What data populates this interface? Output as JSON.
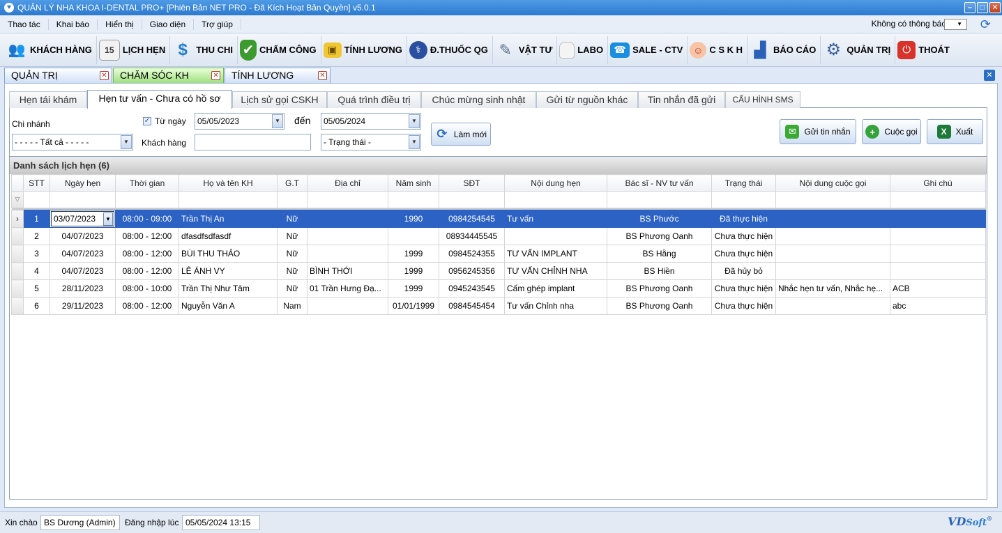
{
  "window": {
    "title": "QUẢN LÝ NHA KHOA I-DENTAL PRO+ [Phiên Bản NET PRO - Đã Kích Hoạt Bản Quyền] v5.0.1"
  },
  "menu": {
    "items": [
      "Thao tác",
      "Khai báo",
      "Hiển thị",
      "Giao diện",
      "Trợ giúp"
    ],
    "notification": "Không có thông báo"
  },
  "toolbar": {
    "items": [
      {
        "label": "KHÁCH HÀNG",
        "icon": "customers-icon"
      },
      {
        "label": "LỊCH HẸN",
        "icon": "calendar-icon"
      },
      {
        "label": "THU CHI",
        "icon": "dollar-icon"
      },
      {
        "label": "CHẤM CÔNG",
        "icon": "shield-check-icon"
      },
      {
        "label": "TÍNH LƯƠNG",
        "icon": "wallet-icon"
      },
      {
        "label": "Đ.THUỐC QG",
        "icon": "medicine-icon"
      },
      {
        "label": "VẬT TƯ",
        "icon": "syringe-icon"
      },
      {
        "label": "LABO",
        "icon": "tooth-icon"
      },
      {
        "label": "SALE - CTV",
        "icon": "phone-icon"
      },
      {
        "label": "C S K H",
        "icon": "support-agent-icon"
      },
      {
        "label": "BÁO CÁO",
        "icon": "report-icon"
      },
      {
        "label": "QUẢN TRỊ",
        "icon": "admin-gear-icon"
      },
      {
        "label": "THOÁT",
        "icon": "power-icon"
      }
    ]
  },
  "module_tabs": [
    "QUẢN TRỊ",
    "CHĂM SÓC KH",
    "TÍNH LƯƠNG"
  ],
  "sub_tabs": [
    "Hẹn tái khám",
    "Hẹn tư vấn - Chưa có hồ sơ",
    "Lịch sử gọi CSKH",
    "Quá trình điều trị",
    "Chúc mừng sinh nhật",
    "Gửi từ nguồn khác",
    "Tin nhắn đã gửi",
    "CẤU HÌNH SMS"
  ],
  "filters": {
    "branch_label": "Chi nhánh",
    "branch_value": "- - - - - Tất cả - - - - -",
    "from_label": "Từ ngày",
    "from_date": "05/05/2023",
    "to_label": "đến",
    "to_date": "05/05/2024",
    "customer_label": "Khách hàng",
    "customer_value": "",
    "status_value": "- Trạng thái -",
    "refresh_label": "Làm mới"
  },
  "actions": {
    "send_sms": "Gửi tin nhắn",
    "call": "Cuộc gọi",
    "export": "Xuất"
  },
  "grid": {
    "caption": "Danh sách lịch hẹn (6)",
    "columns": [
      "STT",
      "Ngày hẹn",
      "Thời gian",
      "Họ và tên KH",
      "G.T",
      "Địa chỉ",
      "Năm sinh",
      "SĐT",
      "Nội dung hẹn",
      "Bác sĩ - NV tư vấn",
      "Trạng thái",
      "Nội dung cuộc gọi",
      "Ghi chú"
    ],
    "rows": [
      [
        "1",
        "03/07/2023",
        "08:00 - 09:00",
        "Trần Thị An",
        "Nữ",
        "",
        "1990",
        "0984254545",
        "Tư vấn",
        "BS Phước",
        "Đã thực hiện",
        "",
        ""
      ],
      [
        "2",
        "04/07/2023",
        "08:00 - 12:00",
        "dfasdfsdfasdf",
        "Nữ",
        "",
        "",
        "08934445545",
        "",
        "BS Phương Oanh",
        "Chưa thực hiện",
        "",
        ""
      ],
      [
        "3",
        "04/07/2023",
        "08:00 - 12:00",
        "BÙI THU THẢO",
        "Nữ",
        "",
        "1999",
        "0984524355",
        "TƯ VẤN IMPLANT",
        "BS Hằng",
        "Chưa thực hiện",
        "",
        ""
      ],
      [
        "4",
        "04/07/2023",
        "08:00 - 12:00",
        "LÊ ÁNH VY",
        "Nữ",
        "BÌNH THỚI",
        "1999",
        "0956245356",
        "TƯ VẤN CHỈNH NHA",
        "BS Hiền",
        "Đã hủy bỏ",
        "",
        ""
      ],
      [
        "5",
        "28/11/2023",
        "08:00 - 10:00",
        "Trần Thị Như Tâm",
        "Nữ",
        "01 Trần Hưng Đạ...",
        "1999",
        "0945243545",
        "Cấm ghép implant",
        "BS Phương Oanh",
        "Chưa thực hiện",
        "Nhắc hẹn tư vấn, Nhắc hẹ...",
        "ACB"
      ],
      [
        "6",
        "29/11/2023",
        "08:00 - 12:00",
        "Nguyễn Văn A",
        "Nam",
        "",
        "01/01/1999",
        "0984545454",
        "Tư vấn Chỉnh nha",
        "BS Phương Oanh",
        "Chưa thực hiện",
        "",
        "abc"
      ]
    ]
  },
  "status": {
    "greeting_label": "Xin chào",
    "user": "BS Dương (Admin)",
    "login_label": "Đăng nhập lúc",
    "login_time": "05/05/2024 13:15",
    "logo_main": "VD",
    "logo_sub": "Soft",
    "logo_mark": "®"
  }
}
